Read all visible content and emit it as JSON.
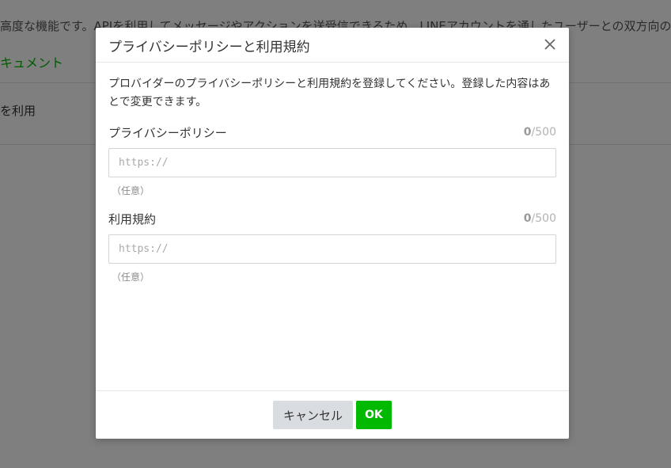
{
  "background": {
    "description": "高度な機能です。APIを利用してメッセージやアクションを送受信できるため、LINEアカウントを通したユーザーとの双方向のコ",
    "link": "キュメント",
    "item": "を利用"
  },
  "modal": {
    "title": "プライバシーポリシーと利用規約",
    "close_icon": "close-icon",
    "description": "プロバイダーのプライバシーポリシーと利用規約を登録してください。登録した内容はあとで変更できます。",
    "fields": [
      {
        "label": "プライバシーポリシー",
        "count": "0",
        "max": "/500",
        "value": "",
        "placeholder": "https://",
        "hint": "（任意）"
      },
      {
        "label": "利用規約",
        "count": "0",
        "max": "/500",
        "value": "",
        "placeholder": "https://",
        "hint": "（任意）"
      }
    ],
    "footer": {
      "cancel_label": "キャンセル",
      "ok_label": "OK"
    }
  },
  "colors": {
    "accent": "#00b900",
    "cancel_bg": "#d9dde2",
    "overlay": "rgba(0,0,0,0.5)"
  }
}
